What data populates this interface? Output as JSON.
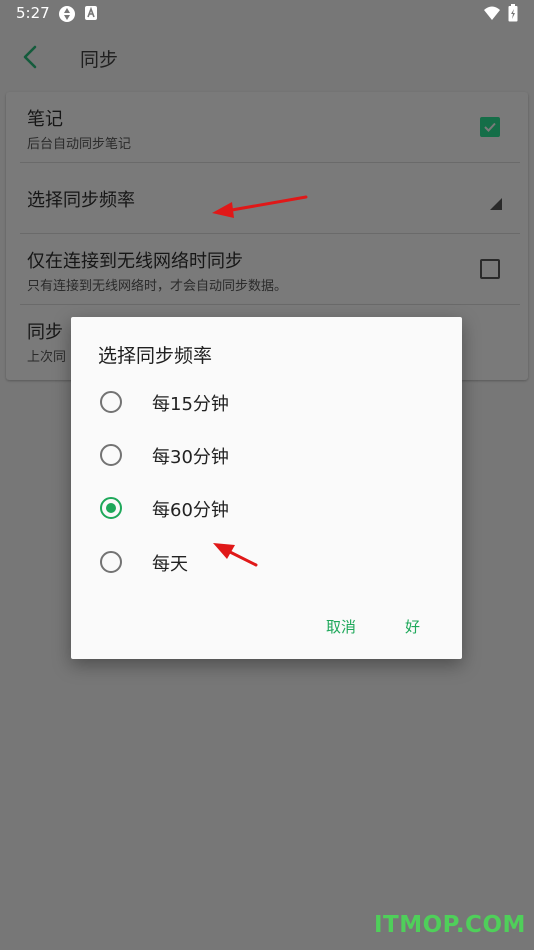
{
  "status_bar": {
    "time": "5:27"
  },
  "app_bar": {
    "title": "同步"
  },
  "settings": {
    "notes": {
      "title": "笔记",
      "subtitle": "后台自动同步笔记",
      "checked": true
    },
    "frequency": {
      "title": "选择同步频率"
    },
    "wifi_only": {
      "title": "仅在连接到无线网络时同步",
      "subtitle": "只有连接到无线网络时，才会自动同步数据。",
      "checked": false
    },
    "sync_now": {
      "title": "同步",
      "subtitle": "上次同"
    }
  },
  "dialog": {
    "title": "选择同步频率",
    "options": [
      {
        "label": "每15分钟",
        "selected": false
      },
      {
        "label": "每30分钟",
        "selected": false
      },
      {
        "label": "每60分钟",
        "selected": true
      },
      {
        "label": "每天",
        "selected": false
      }
    ],
    "cancel_label": "取消",
    "ok_label": "好"
  },
  "watermark": "ITMOP.COM",
  "colors": {
    "accent": "#1ea85a",
    "checkbox_on": "#156e48",
    "scrim": "#777777",
    "annotation_arrow": "#e01818"
  }
}
